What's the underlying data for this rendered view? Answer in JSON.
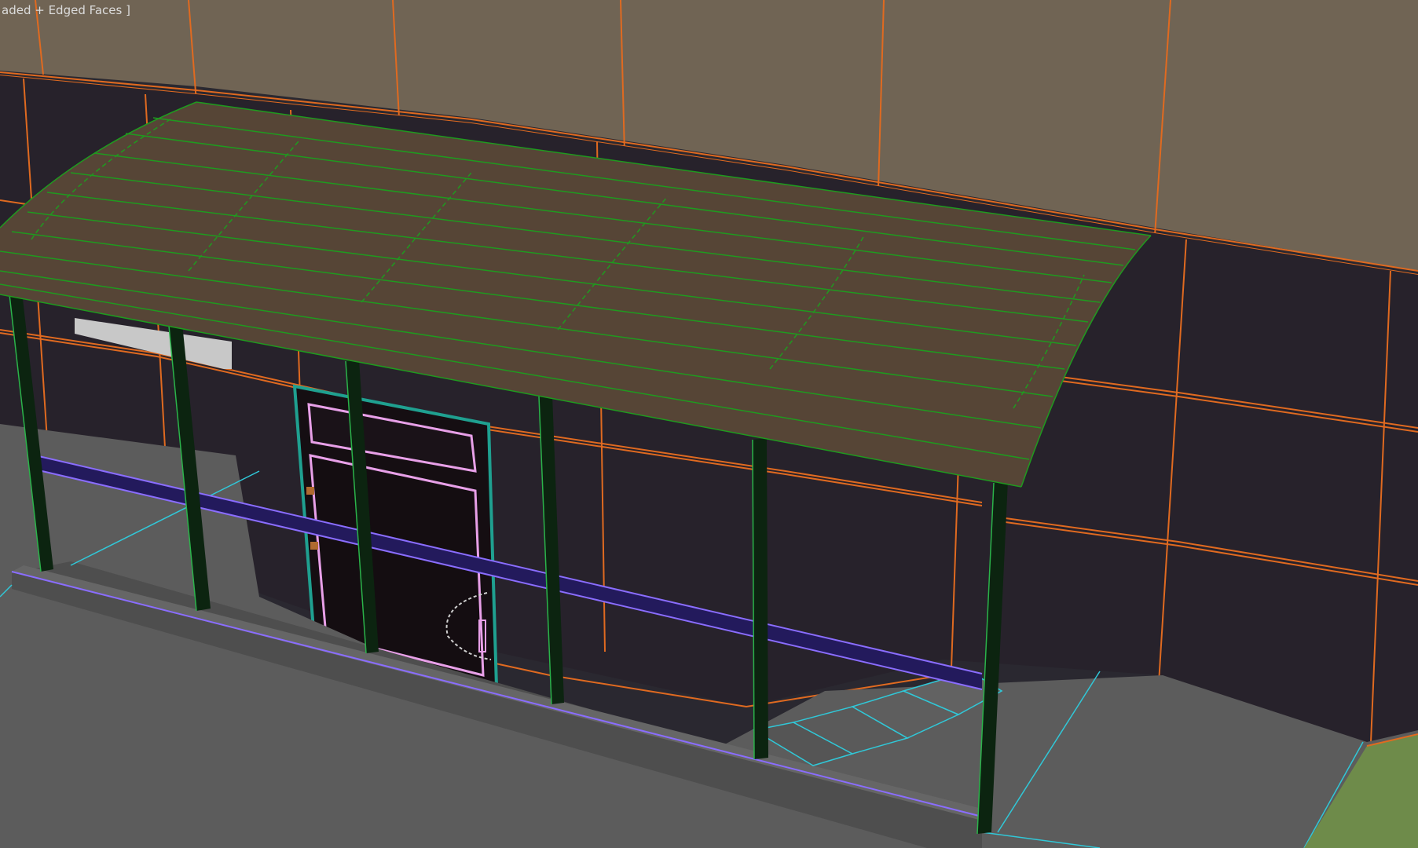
{
  "viewport": {
    "label": "aded + Edged Faces ]",
    "shading_mode": "Edged Faces"
  },
  "colors": {
    "background_wall_upper": "#706454",
    "background_wall_lower": "#27222b",
    "wall_edges": "#e06a20",
    "canopy_fill": "#564536",
    "canopy_edges": "#1f9a1f",
    "posts": "#0c2410",
    "post_edges": "#2bb34a",
    "rail": "#231a5c",
    "rail_edges": "#8a6dff",
    "floor": "#5c5c5c",
    "floor_edges": "#30c8d8",
    "door": "#150e12",
    "door_frame": "#1fa090",
    "door_trim": "#e8a0e8",
    "grass": "#6e8b4a",
    "window_sill": "#c8c8c8"
  },
  "scene_objects": [
    "upper-wall",
    "lower-wall",
    "canopy",
    "posts",
    "handrail",
    "door",
    "porch-slab",
    "stairs",
    "grass-patch",
    "window-sill"
  ]
}
